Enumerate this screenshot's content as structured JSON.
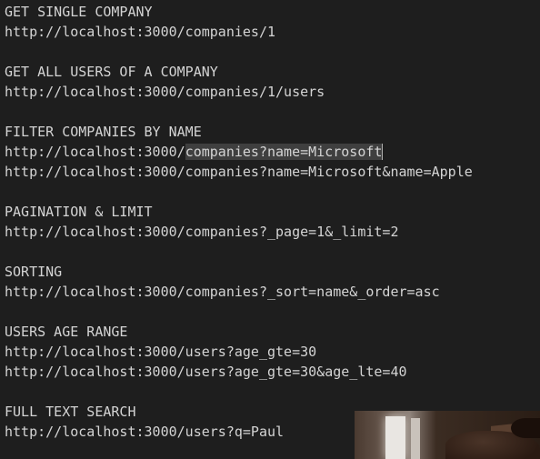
{
  "editor": {
    "lines": [
      "GET SINGLE COMPANY",
      "http://localhost:3000/companies/1",
      "",
      "GET ALL USERS OF A COMPANY",
      "http://localhost:3000/companies/1/users",
      "",
      "FILTER COMPANIES BY NAME",
      "http://localhost:3000/",
      "http://localhost:3000/companies?name=Microsoft&name=Apple",
      "",
      "PAGINATION & LIMIT",
      "http://localhost:3000/companies?_page=1&_limit=2",
      "",
      "SORTING",
      "http://localhost:3000/companies?_sort=name&_order=asc",
      "",
      "USERS AGE RANGE",
      "http://localhost:3000/users?age_gte=30",
      "http://localhost:3000/users?age_gte=30&age_lte=40",
      "",
      "FULL TEXT SEARCH",
      "http://localhost:3000/users?q=Paul"
    ],
    "selected_text": "companies?name=Microsoft"
  },
  "colors": {
    "background": "#1e1e1e",
    "text": "#d4d4d4",
    "selection": "#3f3f3f"
  }
}
